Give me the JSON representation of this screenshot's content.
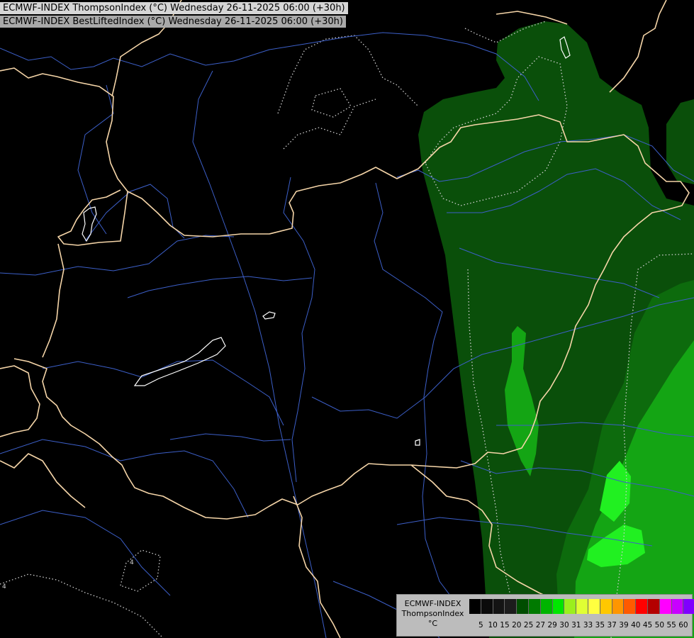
{
  "header": {
    "line1": "ECMWF-INDEX ThompsonIndex (°C) Wednesday 26-11-2025 06:00 (+30h)",
    "line2": "ECMWF-INDEX BestLiftedIndex (°C) Wednesday 26-11-2025 06:00 (+30h)"
  },
  "legend": {
    "title_lines": [
      "ECMWF-INDEX",
      "ThompsonIndex",
      "°C"
    ],
    "colors": [
      "#000000",
      "#0b0b0b",
      "#141414",
      "#1c1c1c",
      "#004d00",
      "#007a00",
      "#00b400",
      "#00e600",
      "#9bef1d",
      "#e0ff34",
      "#ffff40",
      "#ffc800",
      "#ff9600",
      "#ff5a00",
      "#ff0000",
      "#b40000",
      "#ff00ff",
      "#c800ff",
      "#8000ff",
      "#4000ff",
      "#0000ff"
    ],
    "ticks": [
      "5",
      "10",
      "15",
      "20",
      "25",
      "27",
      "29",
      "30",
      "31",
      "33",
      "35",
      "37",
      "39",
      "40",
      "45",
      "50",
      "55",
      "60"
    ]
  },
  "map_colors": {
    "ti_20_25": "#0a4f0a",
    "ti_25_27": "#0d6b0d",
    "ti_27_29": "#14a514",
    "ti_29_30": "#1ed21e",
    "ti_30_31": "#21f021",
    "border": "#f5d5a8",
    "river": "#3c5fc8",
    "lake": "#ffffff",
    "bli_contour": "#cfcfcf"
  }
}
